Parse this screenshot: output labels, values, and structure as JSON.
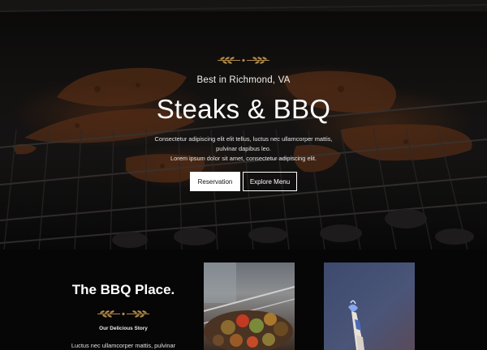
{
  "hero": {
    "subtitle": "Best in Richmond, VA",
    "title": "Steaks & BBQ",
    "description_lines": [
      "Consectetur adipiscing elit elit tellus, luctus nec ullamcorper mattis,",
      "pulvinar dapibus leo.",
      "Lorem ipsum dolor sit amet, consectetur adipiscing elit."
    ],
    "reservation_label": "Reservation",
    "menu_label": "Explore Menu",
    "ornament_icon": "wheat-laurel-icon"
  },
  "about": {
    "title": "The BBQ Place.",
    "story_label": "Our Delicious Story",
    "text": "Luctus nec ullamcorper mattis, pulvinar"
  },
  "colors": {
    "accent_gold": "#b08a4a",
    "background": "#050505",
    "button_light": "#ffffff"
  }
}
